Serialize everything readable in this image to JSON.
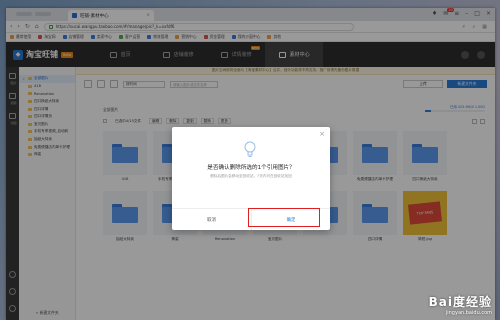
{
  "browser": {
    "tab_title": "旺铺-素材中心",
    "url": "https://sucai.wangpu.taobao.com/#/manage/pic?_k=xxfdf6",
    "controls": {
      "badge": "10"
    },
    "bookmarks": [
      "最常使用",
      "淘宝网",
      "店铺管理",
      "卖家中心",
      "客户运营",
      "物流管理",
      "营销中心",
      "资金管理",
      "我的沙窗中心",
      "其他"
    ]
  },
  "app": {
    "brand": "淘宝旺铺",
    "brand_tag": "Beta",
    "nav_tabs": [
      {
        "label": "首页",
        "active": false,
        "new": false
      },
      {
        "label": "店铺装修",
        "active": false,
        "new": false
      },
      {
        "label": "详情装修",
        "active": false,
        "new": true
      },
      {
        "label": "素材中心",
        "active": true,
        "new": false
      }
    ],
    "new_tag": "NEW"
  },
  "left_rail": [
    "图片",
    "视频",
    "动图"
  ],
  "folders": {
    "items": [
      {
        "label": "全部图片",
        "selected": true,
        "expanded": true
      },
      {
        "label": "418",
        "selected": false
      },
      {
        "label": "Renovation",
        "selected": false
      },
      {
        "label": "四口换纸大特卖",
        "selected": false
      },
      {
        "label": "四口详情",
        "selected": false
      },
      {
        "label": "四口详情页",
        "selected": false
      },
      {
        "label": "宝贝图片",
        "selected": false
      },
      {
        "label": "手机专享视频_自动转",
        "selected": false
      },
      {
        "label": "抽纸大特卖",
        "selected": false
      },
      {
        "label": "免费便捷店内单卡护理",
        "selected": false
      },
      {
        "label": "神姿",
        "selected": false
      }
    ],
    "new_folder": "+ 新建文件夹"
  },
  "main": {
    "notice": "图片空间即将全面与【淘宝素材中心】合并，部分功能将不再支持，推广前请先备份图片数据",
    "sort_label": "按时间",
    "search_placeholder": "请输入图片或文件名称",
    "upload_btn": "上传",
    "new_folder_btn": "新建文件夹",
    "breadcrumb": "全部图片",
    "capacity": "已用 425.9M/4 1.00G",
    "capacity_pct": 0.1,
    "select_all": "已选中4/15文件",
    "ops": [
      "编辑",
      "删除",
      "复制",
      "替换",
      "更多"
    ],
    "grid": [
      {
        "label": "418",
        "type": "folder"
      },
      {
        "label": "手机专享视频_自动转",
        "type": "folder"
      },
      {
        "label": "",
        "type": "folder"
      },
      {
        "label": "",
        "type": "folder"
      },
      {
        "label": "",
        "type": "folder"
      },
      {
        "label": "免费便捷店内单卡护理",
        "type": "folder"
      },
      {
        "label": "四口换纸大特卖",
        "type": "folder"
      },
      {
        "label": "抽纸大特卖",
        "type": "folder"
      },
      {
        "label": "神姿",
        "type": "folder"
      },
      {
        "label": "Renovation",
        "type": "folder"
      },
      {
        "label": "宝贝图片",
        "type": "folder"
      },
      {
        "label": "",
        "type": "folder"
      },
      {
        "label": "四口详情",
        "type": "folder"
      },
      {
        "label": "简短.jpg",
        "type": "image",
        "image_text": "TOP FANS"
      }
    ]
  },
  "modal": {
    "title": "是否确认删除所选的1个引用图片？",
    "desc": "删除后图片会移动至回收站，7天内可在回收站找回",
    "cancel": "取消",
    "confirm": "确定"
  },
  "watermark": {
    "line1": "Bai度经验",
    "line2": "jingyan.baidu.com"
  }
}
